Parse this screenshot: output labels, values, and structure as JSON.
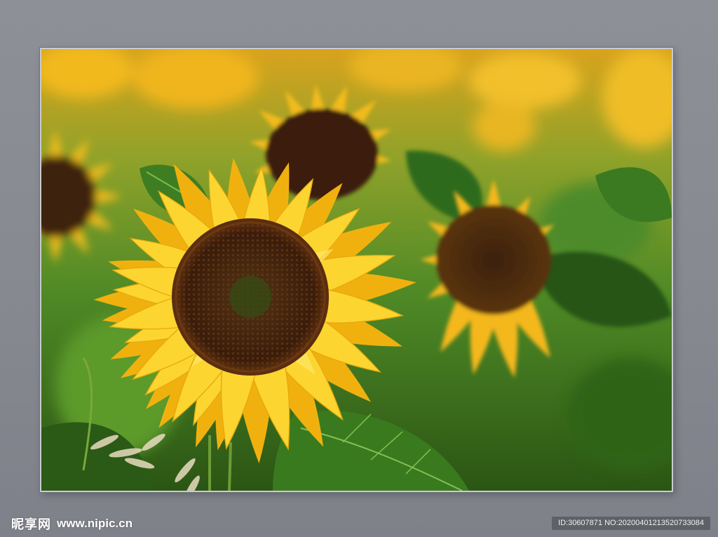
{
  "watermark": {
    "brand": "昵享网",
    "url": "www.nipic.cn",
    "image_id_line": "ID:30607871 NO:20200401213520733084"
  },
  "colors": {
    "wall": "#8a8c94",
    "petal": "#f7c414",
    "petal_light": "#ffe25a",
    "seed_disc": "#3b1d0c",
    "leaf": "#3f7d22",
    "leaf_dark": "#1f4210"
  }
}
